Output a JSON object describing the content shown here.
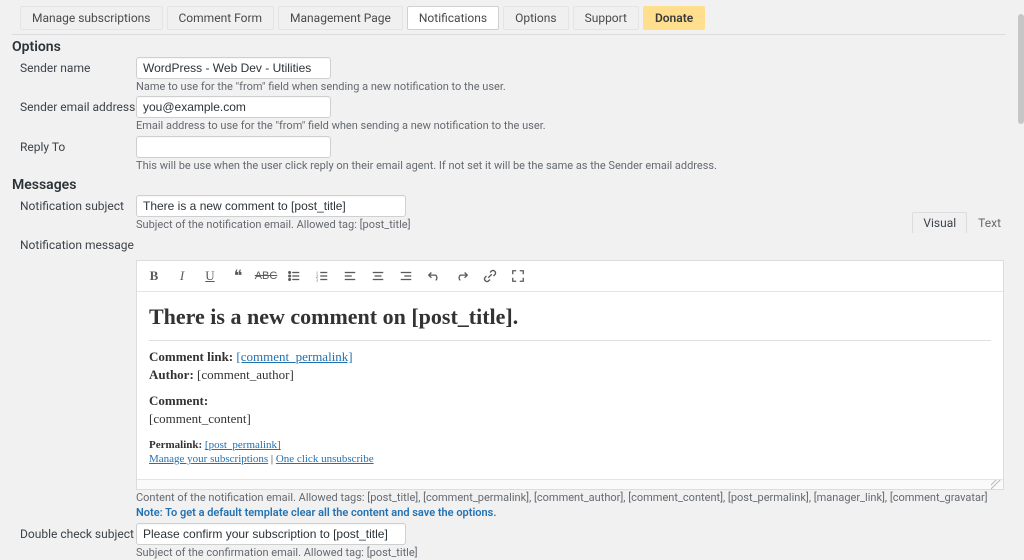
{
  "tabs": {
    "items": [
      {
        "label": "Manage subscriptions"
      },
      {
        "label": "Comment Form"
      },
      {
        "label": "Management Page"
      },
      {
        "label": "Notifications"
      },
      {
        "label": "Options"
      },
      {
        "label": "Support"
      },
      {
        "label": "Donate"
      }
    ]
  },
  "options": {
    "heading": "Options",
    "sender_name": {
      "label": "Sender name",
      "value": "WordPress - Web Dev - Utilities",
      "hint": "Name to use for the \"from\" field when sending a new notification to the user."
    },
    "sender_email": {
      "label": "Sender email address",
      "value": "you@example.com",
      "hint": "Email address to use for the \"from\" field when sending a new notification to the user."
    },
    "reply_to": {
      "label": "Reply To",
      "value": "",
      "hint": "This will be use when the user click reply on their email agent. If not set it will be the same as the Sender email address."
    }
  },
  "messages": {
    "heading": "Messages",
    "subject": {
      "label": "Notification subject",
      "value": "There is a new comment to [post_title]",
      "hint": "Subject of the notification email. Allowed tag: [post_title]"
    },
    "message": {
      "label": "Notification message",
      "tabs": {
        "visual": "Visual",
        "text": "Text"
      },
      "body": {
        "heading": "There is a new comment on [post_title].",
        "comment_link_label": "Comment link:",
        "comment_link_value": "[comment_permalink]",
        "author_label": "Author:",
        "author_value": "[comment_author]",
        "comment_label": "Comment:",
        "comment_value": "[comment_content]",
        "permalink_label": "Permalink:",
        "permalink_value": "[post_permalink]",
        "manage_link": "Manage your subscriptions",
        "sep": " | ",
        "unsub_link": "One click unsubscribe"
      },
      "hint1": "Content of the notification email. Allowed tags: [post_title], [comment_permalink], [comment_author], [comment_content], [post_permalink], [manager_link], [comment_gravatar]",
      "hint2": "Note: To get a default template clear all the content and save the options."
    },
    "double_check": {
      "label": "Double check subject",
      "value": "Please confirm your subscription to [post_title]",
      "hint": "Subject of the confirmation email. Allowed tag: [post_title]"
    }
  }
}
